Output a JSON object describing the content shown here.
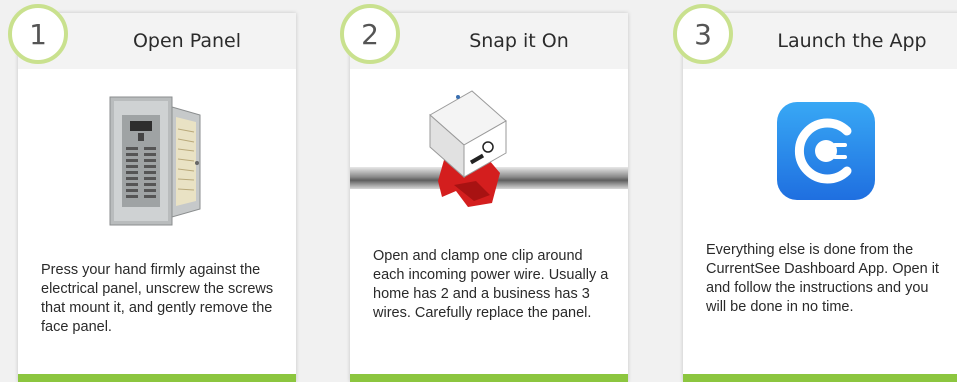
{
  "steps": [
    {
      "number": "1",
      "title": "Open Panel",
      "description": "Press your hand firmly against the electrical panel, unscrew the screws that mount it, and gently remove the face panel.",
      "icon": "electrical-panel-icon"
    },
    {
      "number": "2",
      "title": "Snap it On",
      "description": "Open and clamp one clip around each incoming power wire. Usually a home has 2 and a business has 3 wires. Carefully replace the panel.",
      "icon": "sensor-clip-icon"
    },
    {
      "number": "3",
      "title": "Launch the App",
      "description": "Everything else is done from the CurrentSee Dashboard App. Open it and follow the instructions and you will be done in no time.",
      "icon": "currentsee-app-icon"
    }
  ],
  "colors": {
    "accent_green": "#8cc63f",
    "circle_border": "#c9e18e",
    "app_icon_blue": "#2b8cf0",
    "clip_red": "#d41e1e"
  }
}
